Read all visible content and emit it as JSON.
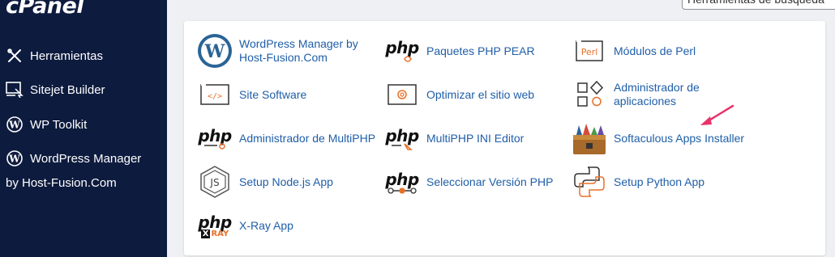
{
  "brand": {
    "logo_text": "cPanel"
  },
  "search": {
    "value": "Herramientas de búsqueda"
  },
  "sidebar": {
    "items": [
      {
        "label": "Herramientas",
        "icon": "tools-icon"
      },
      {
        "label": "Sitejet Builder",
        "icon": "sitejet-icon"
      },
      {
        "label": "WP Toolkit",
        "icon": "wordpress-icon"
      },
      {
        "label_line1": "WordPress Manager",
        "label_line2": "by Host-Fusion.Com",
        "icon": "wordpress-icon"
      }
    ]
  },
  "apps": [
    {
      "label": "WordPress Manager by Host-Fusion.Com",
      "icon": "wordpress-logo-icon"
    },
    {
      "label": "Paquetes PHP PEAR",
      "icon": "php-pear-icon",
      "icon_text": "php"
    },
    {
      "label": "Módulos de Perl",
      "icon": "perl-modules-icon",
      "icon_text": "Perl"
    },
    {
      "label": "Site Software",
      "icon": "site-software-icon",
      "icon_text": "</>"
    },
    {
      "label": "Optimizar el sitio web",
      "icon": "optimize-website-icon"
    },
    {
      "label": "Administrador de aplicaciones",
      "icon": "application-manager-icon"
    },
    {
      "label": "Administrador de MultiPHP",
      "icon": "multiphp-manager-icon",
      "icon_text": "php"
    },
    {
      "label": "MultiPHP INI Editor",
      "icon": "multiphp-ini-editor-icon",
      "icon_text": "php"
    },
    {
      "label": "Softaculous Apps Installer",
      "icon": "softaculous-icon"
    },
    {
      "label": "Setup Node.js App",
      "icon": "nodejs-icon",
      "icon_text": "JS"
    },
    {
      "label": "Seleccionar Versión PHP",
      "icon": "php-version-icon",
      "icon_text": "php"
    },
    {
      "label": "Setup Python App",
      "icon": "python-icon"
    },
    {
      "label": "X-Ray App",
      "icon": "xray-icon",
      "icon_text": "php",
      "icon_subtext": "XRAY"
    }
  ],
  "colors": {
    "sidebar_bg": "#0d1b3e",
    "link": "#1f5ea8",
    "accent_orange": "#e8702a",
    "arrow_pink": "#e8336b"
  }
}
